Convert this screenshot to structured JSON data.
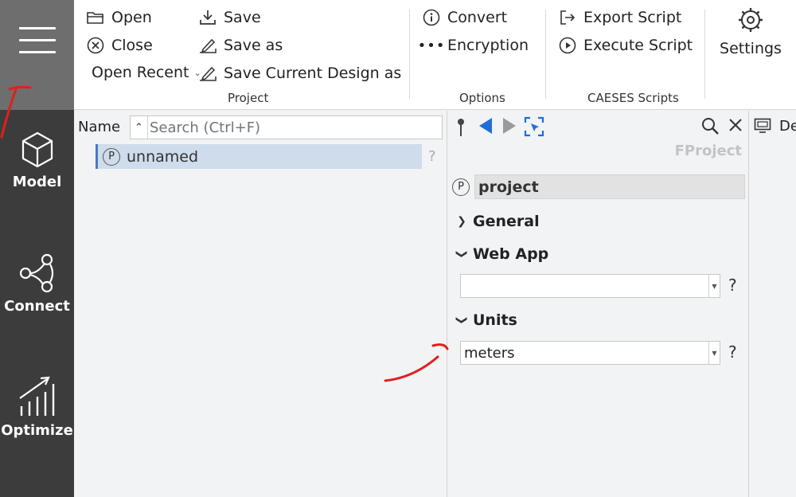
{
  "ribbon": {
    "open": "Open",
    "close": "Close",
    "open_recent": "Open Recent",
    "save": "Save",
    "save_as": "Save as",
    "save_current": "Save Current Design as",
    "convert": "Convert",
    "encryption": "Encryption",
    "export_script": "Export Script",
    "execute_script": "Execute Script",
    "settings": "Settings",
    "group_project": "Project",
    "group_options": "Options",
    "group_scripts": "CAESES Scripts"
  },
  "sidebar": {
    "model": "Model",
    "connect": "Connect",
    "optimize": "Optimize"
  },
  "tree": {
    "name_header": "Name",
    "search_placeholder": "Search (Ctrl+F)",
    "rows": [
      {
        "badge": "P",
        "label": "unnamed"
      }
    ],
    "help": "?"
  },
  "props": {
    "type": "FProject",
    "badge": "P",
    "name": "project",
    "sections": {
      "general": "General",
      "webapp": "Web App",
      "units": "Units"
    },
    "webapp_value": "",
    "units_value": "meters",
    "help": "?"
  },
  "right_pane": {
    "label": "De"
  },
  "colors": {
    "sidebar": "#3c3c3c",
    "menu_active": "#6e6e6e",
    "accent": "#1e6fd9",
    "annotation": "#e0201c"
  }
}
